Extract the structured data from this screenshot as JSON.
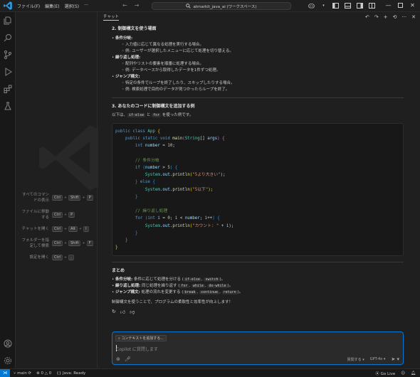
{
  "titlebar": {
    "menus": [
      "ファイル(F)",
      "編集(E)",
      "選択(S)",
      "···"
    ],
    "search_text": "atmarkit_java_ai (ワークスペース)"
  },
  "shortcuts": [
    {
      "label": "すべてのコマンドの表示",
      "keys": [
        "Ctrl",
        "Shift",
        "P"
      ]
    },
    {
      "label": "ファイルに移動する",
      "keys": [
        "Ctrl",
        "P"
      ]
    },
    {
      "label": "チャットを開く",
      "keys": [
        "Ctrl",
        "Alt",
        "I"
      ]
    },
    {
      "label": "フォルダーを指定して検索",
      "keys": [
        "Ctrl",
        "Shift",
        "F"
      ]
    },
    {
      "label": "設定を開く",
      "keys": [
        "Ctrl",
        ","
      ]
    }
  ],
  "chat": {
    "title": "チャット",
    "section2_title": "2. 制御構文を使う場面",
    "cond_title": "条件分岐:",
    "cond_items": [
      "入力値に応じて異なる処理を実行する場合。",
      "例: ユーザーが選択したメニューに応じて処理を切り替える。"
    ],
    "loop_title": "繰り返し処理:",
    "loop_items": [
      "配列やリストの要素を順番に処理する場合。",
      "例: データベースから取得したデータを1件ずつ処理。"
    ],
    "jump_title": "ジャンプ構文:",
    "jump_items": [
      "特定の条件でループを終了したり、スキップしたりする場合。",
      "例: 検索処理で目的のデータが見つかったらループを終了。"
    ],
    "section3_title": "3. あなたのコードに制御構文を追加する例",
    "intro_pre": "以下は、",
    "intro_code1": "if-else",
    "intro_mid": " と ",
    "intro_code2": "for",
    "intro_post": " を使った例です。",
    "code_lines": [
      [
        [
          "kw",
          "public "
        ],
        [
          "kw",
          "class "
        ],
        [
          "ty",
          "App "
        ],
        [
          "br",
          "{"
        ]
      ],
      [
        [
          "pl",
          "    "
        ],
        [
          "kw",
          "public "
        ],
        [
          "kw",
          "static "
        ],
        [
          "kw",
          "void "
        ],
        [
          "fn",
          "main"
        ],
        [
          "br2",
          "("
        ],
        [
          "ty",
          "String"
        ],
        [
          "pl",
          "[] "
        ],
        [
          "va",
          "args"
        ],
        [
          "br2",
          ")"
        ],
        [
          "pl",
          " "
        ],
        [
          "br2",
          "{"
        ]
      ],
      [
        [
          "pl",
          "        "
        ],
        [
          "kw",
          "int "
        ],
        [
          "va",
          "number"
        ],
        [
          "pl",
          " = "
        ],
        [
          "nu",
          "10"
        ],
        [
          "pl",
          ";"
        ]
      ],
      [
        [
          "pl",
          ""
        ]
      ],
      [
        [
          "pl",
          "        "
        ],
        [
          "cm",
          "// 条件分岐"
        ]
      ],
      [
        [
          "pl",
          "        "
        ],
        [
          "kw",
          "if "
        ],
        [
          "br3",
          "("
        ],
        [
          "va",
          "number"
        ],
        [
          "pl",
          " > "
        ],
        [
          "nu",
          "5"
        ],
        [
          "br3",
          ")"
        ],
        [
          "pl",
          " "
        ],
        [
          "br3",
          "{"
        ]
      ],
      [
        [
          "pl",
          "            "
        ],
        [
          "ty",
          "System"
        ],
        [
          "pl",
          "."
        ],
        [
          "va",
          "out"
        ],
        [
          "pl",
          "."
        ],
        [
          "fn",
          "println"
        ],
        [
          "br",
          "("
        ],
        [
          "st",
          "\"5より大きい\""
        ],
        [
          "br",
          ")"
        ],
        [
          "pl",
          ";"
        ]
      ],
      [
        [
          "pl",
          "        "
        ],
        [
          "br3",
          "}"
        ],
        [
          "pl",
          " "
        ],
        [
          "kw",
          "else "
        ],
        [
          "br3",
          "{"
        ]
      ],
      [
        [
          "pl",
          "            "
        ],
        [
          "ty",
          "System"
        ],
        [
          "pl",
          "."
        ],
        [
          "va",
          "out"
        ],
        [
          "pl",
          "."
        ],
        [
          "fn",
          "println"
        ],
        [
          "br",
          "("
        ],
        [
          "st",
          "\"5以下\""
        ],
        [
          "br",
          ")"
        ],
        [
          "pl",
          ";"
        ]
      ],
      [
        [
          "pl",
          "        "
        ],
        [
          "br3",
          "}"
        ]
      ],
      [
        [
          "pl",
          ""
        ]
      ],
      [
        [
          "pl",
          "        "
        ],
        [
          "cm",
          "// 繰り返し処理"
        ]
      ],
      [
        [
          "pl",
          "        "
        ],
        [
          "kw",
          "for "
        ],
        [
          "br3",
          "("
        ],
        [
          "kw",
          "int "
        ],
        [
          "va",
          "i"
        ],
        [
          "pl",
          " = "
        ],
        [
          "nu",
          "0"
        ],
        [
          "pl",
          "; "
        ],
        [
          "va",
          "i"
        ],
        [
          "pl",
          " < "
        ],
        [
          "va",
          "number"
        ],
        [
          "pl",
          "; "
        ],
        [
          "va",
          "i"
        ],
        [
          "pl",
          "++"
        ],
        [
          "br3",
          ")"
        ],
        [
          "pl",
          " "
        ],
        [
          "br3",
          "{"
        ]
      ],
      [
        [
          "pl",
          "            "
        ],
        [
          "ty",
          "System"
        ],
        [
          "pl",
          "."
        ],
        [
          "va",
          "out"
        ],
        [
          "pl",
          "."
        ],
        [
          "fn",
          "println"
        ],
        [
          "br",
          "("
        ],
        [
          "st",
          "\"カウント: \""
        ],
        [
          "pl",
          " + "
        ],
        [
          "va",
          "i"
        ],
        [
          "br",
          ")"
        ],
        [
          "pl",
          ";"
        ]
      ],
      [
        [
          "pl",
          "        "
        ],
        [
          "br3",
          "}"
        ]
      ],
      [
        [
          "pl",
          "    "
        ],
        [
          "br2",
          "}"
        ]
      ],
      [
        [
          "br",
          "}"
        ]
      ]
    ],
    "summary_title": "まとめ",
    "summary_items": [
      {
        "title": "条件分岐:",
        "text": " 条件に応じて処理を分ける (",
        "codes": [
          "if-else",
          "switch"
        ],
        "tail": ")。"
      },
      {
        "title": "繰り返し処理:",
        "text": " 同じ処理を繰り返す (",
        "codes": [
          "for",
          "while",
          "do-while"
        ],
        "tail": ")。"
      },
      {
        "title": "ジャンプ構文:",
        "text": " 処理の流れを変更する (",
        "codes": [
          "break",
          "continue",
          "return"
        ],
        "tail": ")。"
      }
    ],
    "conclusion": "制御構文を使うことで、プログラムの柔軟性と効率性が向上します！",
    "input": {
      "context_button": "コンテキストを追加する...",
      "placeholder": "Copilot に質問します",
      "mode": "質問する",
      "model": "GPT-4o"
    }
  },
  "statusbar": {
    "branch": "main",
    "errors": "0",
    "warnings": "0",
    "java": "Java: Ready",
    "golive": "Go Live"
  }
}
